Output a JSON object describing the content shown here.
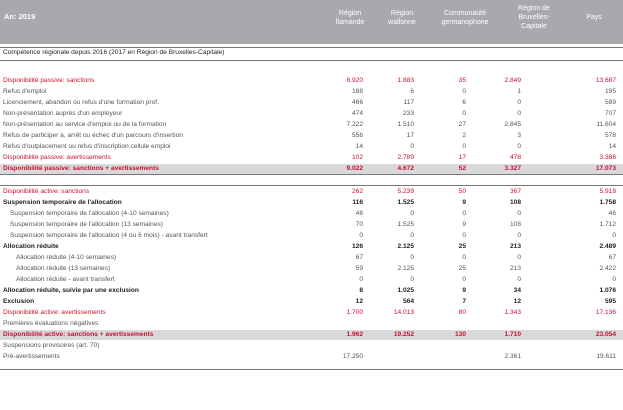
{
  "header": {
    "year": "An: 2019",
    "cols": [
      "Région flamande",
      "Région wallonne",
      "Communauté germanophone",
      "Région de Bruxelles-Capitale",
      "Pays"
    ]
  },
  "section_title": "Compétence régionale depuis 2016 (2017 en Région de Bruxelles-Capitale)",
  "rows": [
    {
      "label": "Disponibilité passive: sanctions",
      "v": [
        "8.920",
        "1.883",
        "35",
        "2.849",
        "13.687"
      ],
      "style": "red"
    },
    {
      "label": "Refus d'emploi",
      "v": [
        "188",
        "6",
        "0",
        "1",
        "195"
      ],
      "style": "n"
    },
    {
      "label": "Licenciement, abandon ou refus d'une formation prof.",
      "v": [
        "466",
        "117",
        "6",
        "0",
        "589"
      ],
      "style": "n"
    },
    {
      "label": "Non-présentation auprès d'un employeur",
      "v": [
        "474",
        "233",
        "0",
        "0",
        "707"
      ],
      "style": "n"
    },
    {
      "label": "Non-présentation au service d'emploi ou de la formation",
      "v": [
        "7.222",
        "1.510",
        "27",
        "2.845",
        "11.604"
      ],
      "style": "n"
    },
    {
      "label": "Refus de participer à, arrêt ou échec d'un parcours d'insertion",
      "v": [
        "556",
        "17",
        "2",
        "3",
        "578"
      ],
      "style": "n"
    },
    {
      "label": "Refus d'outplacement ou refus d'inscription cellule emploi",
      "v": [
        "14",
        "0",
        "0",
        "0",
        "14"
      ],
      "style": "n"
    },
    {
      "label": "Disponibilité passive: avertissements",
      "v": [
        "102",
        "2.789",
        "17",
        "478",
        "3.386"
      ],
      "style": "red"
    },
    {
      "label": "Disponibilité passive: sanctions + avertissements",
      "v": [
        "9.022",
        "4.672",
        "52",
        "3.327",
        "17.073"
      ],
      "style": "redshade"
    },
    {
      "label": "Disponibilité active: sanctions",
      "v": [
        "262",
        "5.239",
        "50",
        "367",
        "5.918"
      ],
      "style": "red"
    },
    {
      "label": "Suspension temporaire de l'allocation",
      "v": [
        "116",
        "1.525",
        "9",
        "108",
        "1.758"
      ],
      "style": "bold"
    },
    {
      "label": "Suspension temporaire de l'allocation (4-10 semaines)",
      "v": [
        "46",
        "0",
        "0",
        "0",
        "46"
      ],
      "style": "i1"
    },
    {
      "label": "Suspension temporaire de l'allocation (13 semaines)",
      "v": [
        "70",
        "1.525",
        "9",
        "108",
        "1.712"
      ],
      "style": "i1"
    },
    {
      "label": "Suspension temporaire de l'allocation (4 ou 6 mois) - avant transfert",
      "v": [
        "0",
        "0",
        "0",
        "0",
        "0"
      ],
      "style": "i1"
    },
    {
      "label": "Allocation réduite",
      "v": [
        "126",
        "2.125",
        "25",
        "213",
        "2.489"
      ],
      "style": "bold"
    },
    {
      "label": "Allocation réduite (4-10 semaines)",
      "v": [
        "67",
        "0",
        "0",
        "0",
        "67"
      ],
      "style": "i2"
    },
    {
      "label": "Allocation réduite (13 semaines)",
      "v": [
        "59",
        "2.125",
        "25",
        "213",
        "2.422"
      ],
      "style": "i2"
    },
    {
      "label": "Allocation réduite - avant transfert",
      "v": [
        "0",
        "0",
        "0",
        "0",
        "0"
      ],
      "style": "i2"
    },
    {
      "label": "Allocation réduite, suivie par une exclusion",
      "v": [
        "8",
        "1.025",
        "9",
        "34",
        "1.076"
      ],
      "style": "bold"
    },
    {
      "label": "Exclusion",
      "v": [
        "12",
        "564",
        "7",
        "12",
        "595"
      ],
      "style": "bold"
    },
    {
      "label": "Disponibilité active: avertissements",
      "v": [
        "1.700",
        "14.013",
        "80",
        "1.343",
        "17.136"
      ],
      "style": "red"
    },
    {
      "label": "Premières évaluations négatives",
      "v": [
        "",
        "",
        "",
        "",
        ""
      ],
      "style": "n"
    },
    {
      "label": "Disponibilité active: sanctions + avertissements",
      "v": [
        "1.962",
        "19.252",
        "130",
        "1.710",
        "23.054"
      ],
      "style": "redshade"
    },
    {
      "label": "Suspensions provisoires (art. 70)",
      "v": [
        "",
        "",
        "",
        "",
        ""
      ],
      "style": "n"
    },
    {
      "label": "Pré-avertissements",
      "v": [
        "17.250",
        "",
        "",
        "2.361",
        "19.611"
      ],
      "style": "n"
    }
  ]
}
